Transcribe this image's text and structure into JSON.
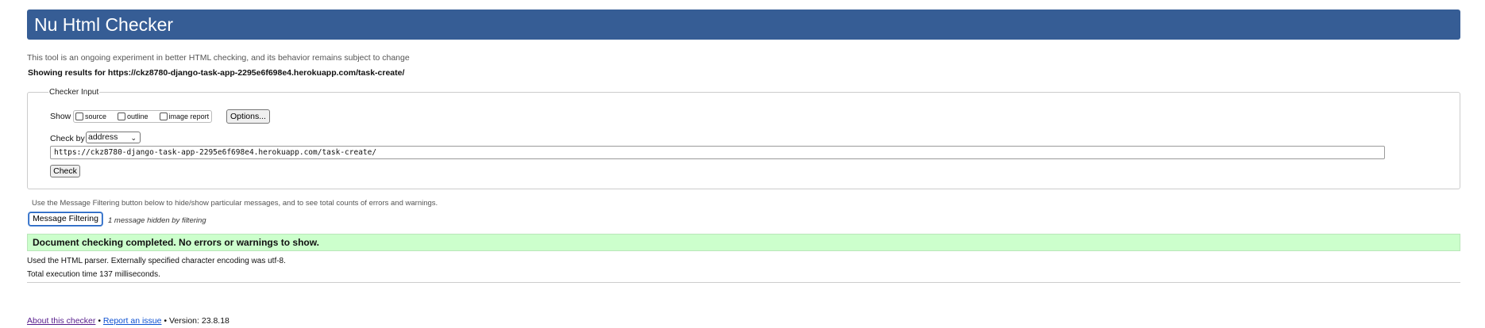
{
  "header": {
    "title": "Nu Html Checker"
  },
  "subtitle": "This tool is an ongoing experiment in better HTML checking, and its behavior remains subject to change",
  "results_heading": "Showing results for https://ckz8780-django-task-app-2295e6f698e4.herokuapp.com/task-create/",
  "checker_input": {
    "legend": "Checker Input",
    "show_label": "Show",
    "show_options": [
      {
        "label": "source",
        "checked": false
      },
      {
        "label": "outline",
        "checked": false
      },
      {
        "label": "image report",
        "checked": false
      }
    ],
    "options_button": "Options...",
    "check_by_label": "Check by",
    "check_by_selected": "address",
    "url_value": "https://ckz8780-django-task-app-2295e6f698e4.herokuapp.com/task-create/",
    "check_button": "Check"
  },
  "filtering": {
    "help_text": "Use the Message Filtering button below to hide/show particular messages, and to see total counts of errors and warnings.",
    "button": "Message Filtering",
    "hidden_note": "1 message hidden by filtering"
  },
  "status": {
    "message": "Document checking completed. No errors or warnings to show.",
    "color": "#ccffcc"
  },
  "info": {
    "parser": "Used the HTML parser. Externally specified character encoding was utf-8.",
    "time": "Total execution time 137 milliseconds."
  },
  "footer": {
    "about_link": "About this checker",
    "separator": "•",
    "report_link": "Report an issue",
    "version": "Version: 23.8.18"
  },
  "colors": {
    "header_bg": "#365d95",
    "visited_link": "#551a8b",
    "link": "#0b4fd1"
  }
}
